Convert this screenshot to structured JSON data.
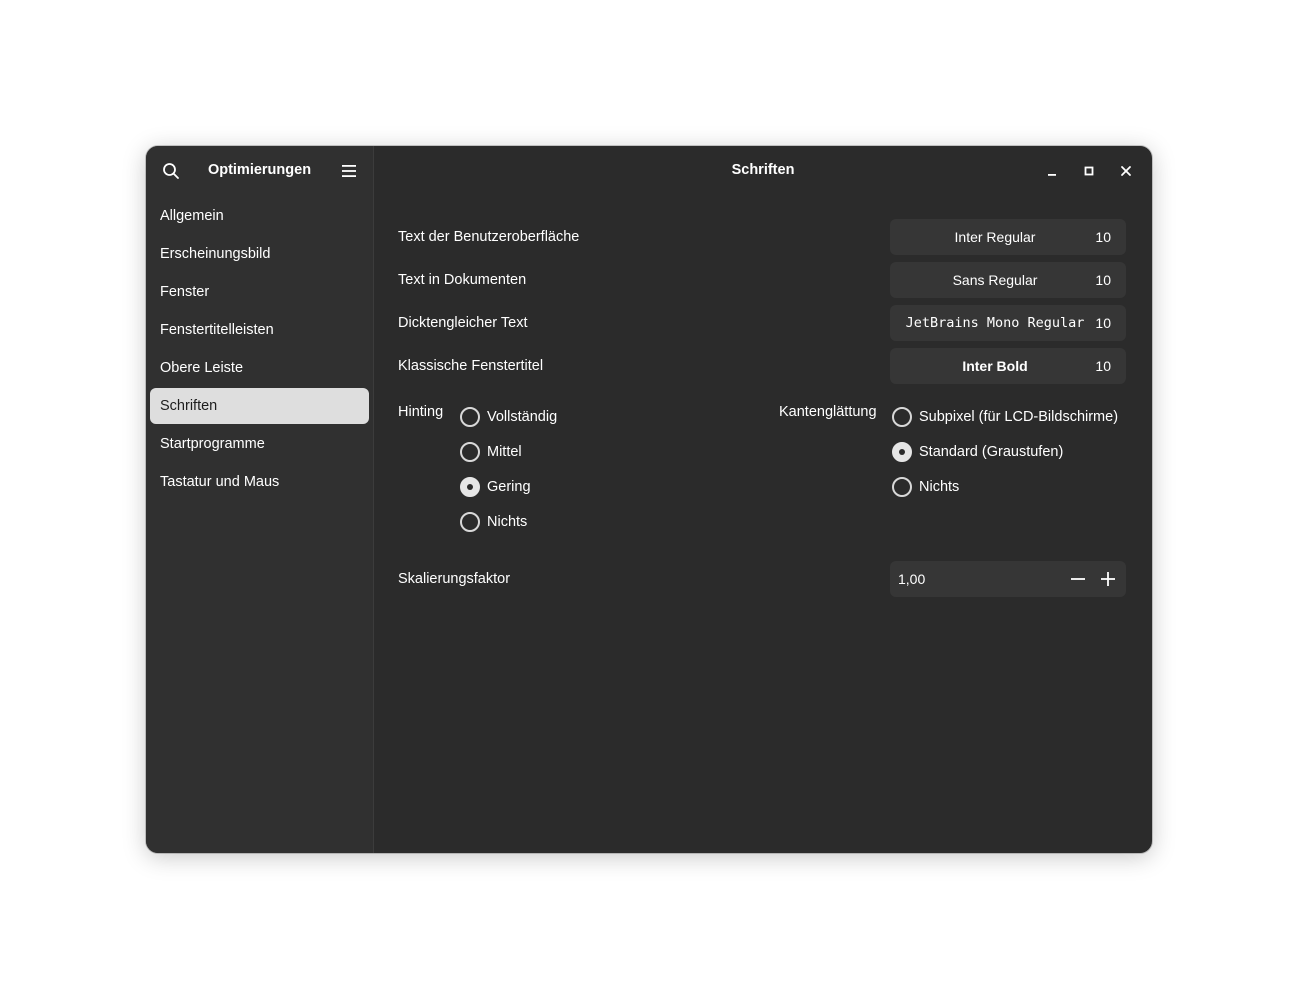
{
  "sidebar": {
    "title": "Optimierungen",
    "search_icon": "search-icon",
    "menu_icon": "hamburger-menu-icon",
    "items": [
      {
        "label": "Allgemein"
      },
      {
        "label": "Erscheinungsbild"
      },
      {
        "label": "Fenster"
      },
      {
        "label": "Fenstertitelleisten"
      },
      {
        "label": "Obere Leiste"
      },
      {
        "label": "Schriften",
        "active": true
      },
      {
        "label": "Startprogramme"
      },
      {
        "label": "Tastatur und Maus"
      }
    ]
  },
  "main": {
    "title": "Schriften",
    "window_controls": [
      "minimize-icon",
      "maximize-icon",
      "close-icon"
    ],
    "fonts": [
      {
        "label": "Text der Benutzeroberfläche",
        "font": "Inter Regular",
        "size": "10"
      },
      {
        "label": "Text in Dokumenten",
        "font": "Sans Regular",
        "size": "10"
      },
      {
        "label": "Dicktengleicher Text",
        "font": "JetBrains Mono Regular",
        "size": "10"
      },
      {
        "label": "Klassische Fenstertitel",
        "font": "Inter Bold",
        "size": "10"
      }
    ],
    "hinting": {
      "label": "Hinting",
      "options": [
        {
          "label": "Vollständig",
          "checked": false
        },
        {
          "label": "Mittel",
          "checked": false
        },
        {
          "label": "Gering",
          "checked": true
        },
        {
          "label": "Nichts",
          "checked": false
        }
      ]
    },
    "antialiasing": {
      "label": "Kantenglättung",
      "options": [
        {
          "label": "Subpixel (für LCD-Bildschirme)",
          "checked": false
        },
        {
          "label": "Standard (Graustufen)",
          "checked": true
        },
        {
          "label": "Nichts",
          "checked": false
        }
      ]
    },
    "scaling": {
      "label": "Skalierungsfaktor",
      "value": "1,00"
    }
  },
  "colors": {
    "window_bg": "#2b2b2b",
    "sidebar_bg": "#303030",
    "active_item_bg": "#dedede",
    "field_bg": "#363636",
    "text": "#ffffff"
  }
}
